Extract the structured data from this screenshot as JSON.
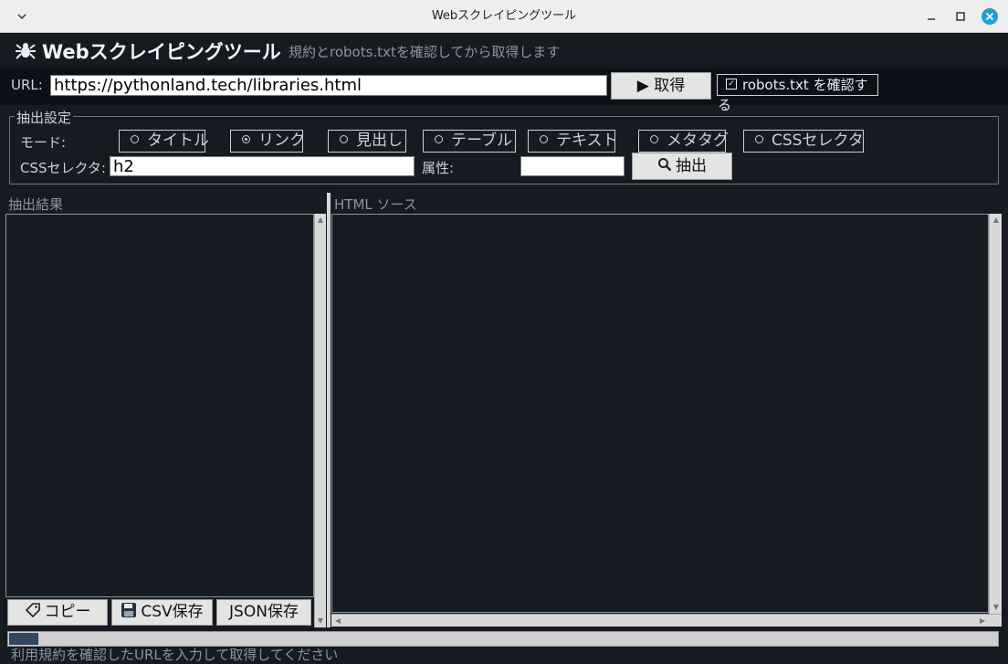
{
  "window": {
    "title": "Webスクレイピングツール"
  },
  "header": {
    "title": "Webスクレイピングツール",
    "subtitle": "規約とrobots.txtを確認してから取得します",
    "icon": "spider-icon"
  },
  "url_row": {
    "label": "URL:",
    "value": "https://pythonland.tech/libraries.html",
    "fetch_label": "▶ 取得",
    "robots_label": "robots.txt を確認する",
    "robots_checked": true
  },
  "settings": {
    "legend": "抽出設定",
    "mode_label": "モード:",
    "modes": [
      "タイトル",
      "リンク",
      "見出し",
      "テーブル",
      "テキスト",
      "メタタグ",
      "CSSセレクタ"
    ],
    "selected_mode": "リンク",
    "selector_label": "CSSセレクタ:",
    "selector_value": "h2",
    "attr_label": "属性:",
    "attr_value": "",
    "extract_label": "抽出"
  },
  "results": {
    "title": "抽出結果",
    "copy_label": "コピー",
    "csv_label": "CSV保存",
    "json_label": "JSON保存"
  },
  "source": {
    "title": "HTML ソース"
  },
  "status": {
    "text": "利用規約を確認したURLを入力して取得してください",
    "progress": 0.03
  },
  "colors": {
    "bg": "#161b22",
    "header_bg": "#0d1117",
    "accent": "#31465f",
    "close": "#1f9ede"
  }
}
